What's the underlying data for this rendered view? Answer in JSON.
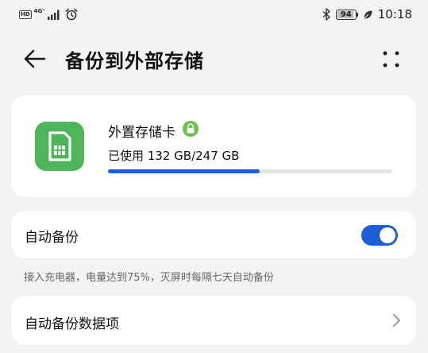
{
  "status_bar": {
    "hd": "HD",
    "network": "4G⁺",
    "battery_level": "94",
    "time": "10:18"
  },
  "header": {
    "title": "备份到外部存储"
  },
  "storage": {
    "name": "外置存储卡",
    "usage": "已使用 132 GB/247 GB",
    "used_fraction": 0.5344
  },
  "auto_backup": {
    "label": "自动备份",
    "enabled": true,
    "hint": "接入充电器，电量达到75%，灭屏时每隔七天自动备份"
  },
  "backup_items": {
    "label": "自动备份数据项"
  },
  "colors": {
    "accent": "#1a5fd6",
    "sd_icon": "#4fb55a",
    "lock_badge": "#6cc04a",
    "background": "#f1f3f5"
  },
  "icons": [
    "sim-signal-icon",
    "alarm-icon",
    "bluetooth-icon",
    "battery-icon",
    "leaf-icon",
    "back-arrow-icon",
    "more-icon",
    "sd-card-icon",
    "lock-icon",
    "chevron-right-icon"
  ]
}
